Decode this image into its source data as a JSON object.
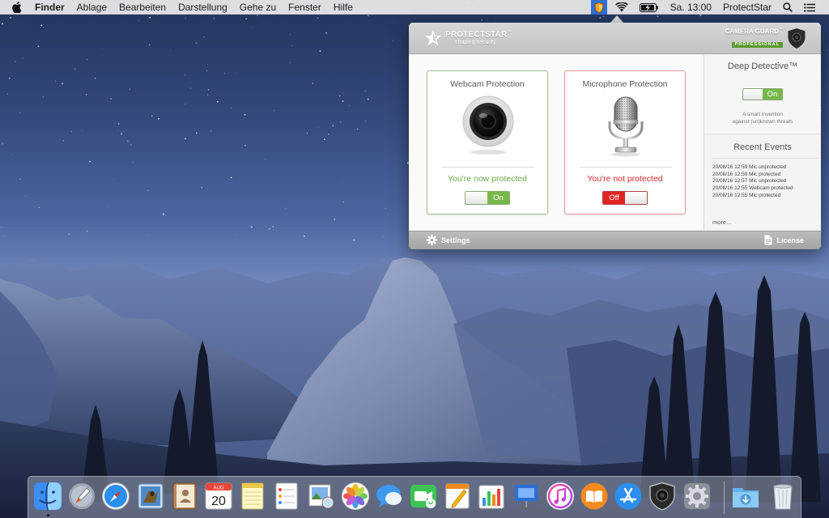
{
  "menubar": {
    "app_name": "Finder",
    "items": [
      "Ablage",
      "Bearbeiten",
      "Darstellung",
      "Gehe zu",
      "Fenster",
      "Hilfe"
    ],
    "clock": "Sa. 13:00",
    "user": "ProtectStar",
    "icons": [
      "apple-icon",
      "protectstar-status-icon",
      "wifi-icon",
      "battery-icon",
      "spotlight-icon",
      "notification-center-icon"
    ]
  },
  "popover": {
    "brand_name": "PROTECTSTAR",
    "brand_tm": "™",
    "brand_tagline": "shaping security",
    "product_name": "CAMERA GUARD",
    "product_tm": "™",
    "product_edition": "PROFESSIONAL",
    "webcam": {
      "title": "Webcam Protection",
      "status": "You're now protected",
      "toggle": "On"
    },
    "microphone": {
      "title": "Microphone Protection",
      "status": "You're not protected",
      "toggle": "Off"
    },
    "deep_detective": {
      "title": "Deep Detective™",
      "toggle": "On",
      "desc_line1": "A smart invention",
      "desc_line2": "against (un)known threats"
    },
    "recent_events": {
      "title": "Recent Events",
      "events": [
        "20/08/16 12:59 Mic unprotected",
        "20/08/16 12:59 Mic protected",
        "20/08/16 12:57 Mic unprotected",
        "20/08/16 12:55 Webcam protected",
        "20/08/16 12:55 Mic protected"
      ],
      "more": "more..."
    },
    "footer": {
      "settings": "Settings",
      "license": "License"
    },
    "colors": {
      "protected_green": "#6ea646",
      "unprotected_red": "#d32a2a",
      "toggle_on": "#78b84a",
      "toggle_off": "#e02424"
    }
  },
  "dock": {
    "calendar_month": "AUG",
    "calendar_day": "20",
    "apps": [
      "finder-icon",
      "launchpad-icon",
      "safari-icon",
      "mail-icon",
      "contacts-icon",
      "calendar-icon",
      "notes-icon",
      "reminders-icon",
      "preview-icon",
      "photos-icon",
      "messages-icon",
      "facetime-icon",
      "pages-icon",
      "numbers-icon",
      "keynote-icon",
      "itunes-icon",
      "ibooks-icon",
      "app-store-icon",
      "camera-guard-icon",
      "system-preferences-icon",
      "downloads-icon",
      "trash-icon"
    ]
  }
}
